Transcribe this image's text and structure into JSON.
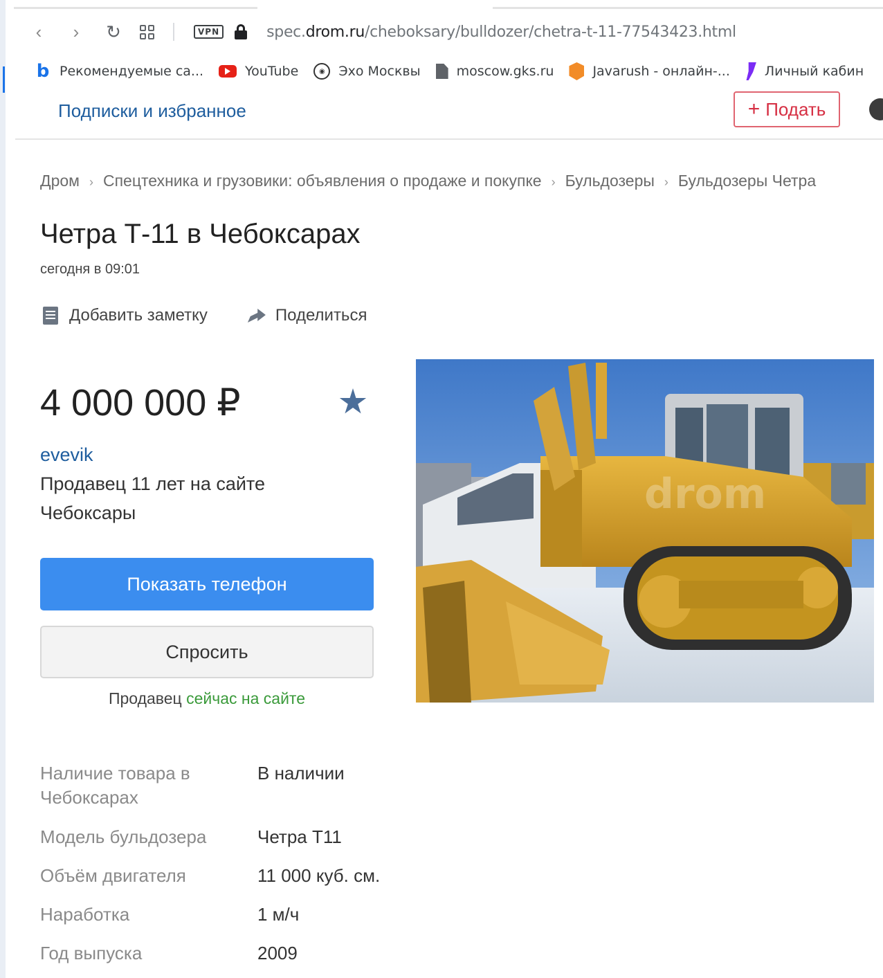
{
  "browser": {
    "url_prefix": "spec.",
    "url_domain": "drom.ru",
    "url_path": "/cheboksary/bulldozer/chetra-t-11-77543423.html",
    "vpn_label": "VPN",
    "bookmarks": [
      {
        "label": "Рекомендуемые са...",
        "icon": "bing-icon"
      },
      {
        "label": "YouTube",
        "icon": "youtube-icon"
      },
      {
        "label": "Эхо Москвы",
        "icon": "echo-moskvy-icon"
      },
      {
        "label": "moscow.gks.ru",
        "icon": "document-icon"
      },
      {
        "label": "Javarush - онлайн-...",
        "icon": "javarush-icon"
      },
      {
        "label": "Личный кабин",
        "icon": "purple-bookmark-icon"
      }
    ]
  },
  "header": {
    "subscriptions_link": "Подписки и избранное",
    "add_button": "Подать",
    "add_button_icon": "+"
  },
  "breadcrumb": [
    "Дром",
    "Спецтехника и грузовики: объявления о продаже и покупке",
    "Бульдозеры",
    "Бульдозеры Четра"
  ],
  "listing": {
    "title": "Четра Т-11 в Чебоксарах",
    "date": "сегодня в 09:01",
    "add_note": "Добавить заметку",
    "share": "Поделиться",
    "price": "4 000 000 ₽"
  },
  "seller": {
    "name": "evevik",
    "since": "Продавец 11 лет на сайте",
    "city": "Чебоксары",
    "show_phone": "Показать телефон",
    "ask": "Спросить",
    "status_prefix": "Продавец",
    "status_online": "сейчас на сайте"
  },
  "photo": {
    "watermark": "drom"
  },
  "specs": [
    {
      "label": "Наличие товара в Чебоксарах",
      "value": "В наличии"
    },
    {
      "label": "Модель бульдозера",
      "value": "Четра Т11"
    },
    {
      "label": "Объём двигателя",
      "value": "11 000 куб. см."
    },
    {
      "label": "Наработка",
      "value": "1 м/ч"
    },
    {
      "label": "Год выпуска",
      "value": "2009"
    }
  ],
  "colors": {
    "link": "#1e5d9e",
    "primary_button": "#3b8def",
    "add_button": "#d62f43",
    "online_green": "#3a9a3a",
    "star": "#4b6e9a"
  }
}
